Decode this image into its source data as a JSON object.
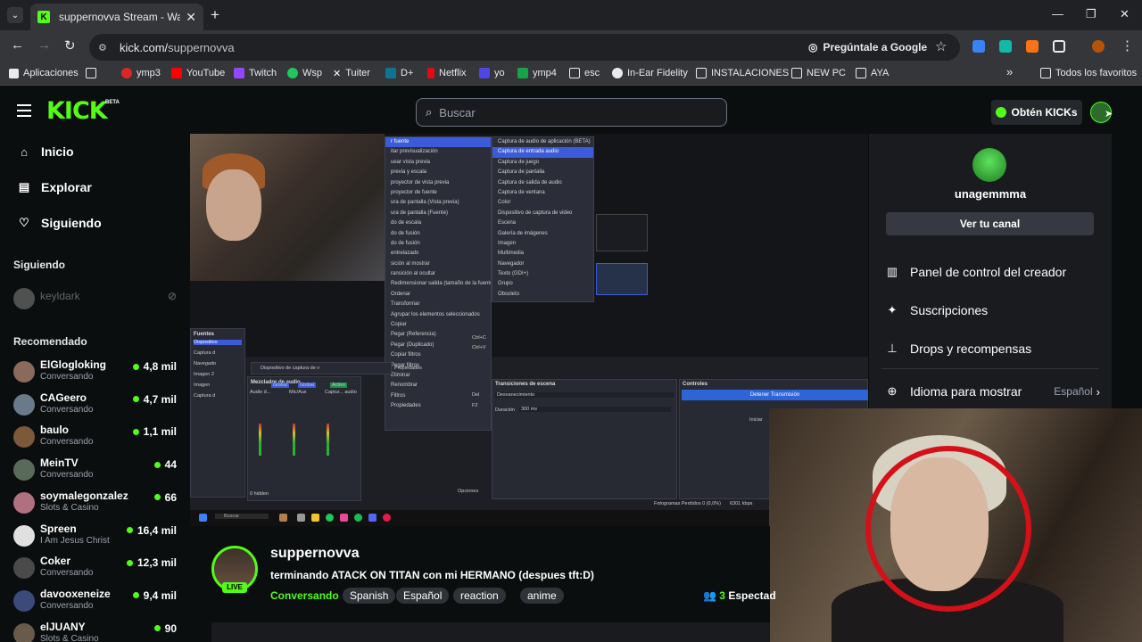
{
  "browser": {
    "tab_title": "suppernovva Stream - Watch Li",
    "url_host": "kick.com/",
    "url_path": "suppernovva",
    "google_pill": "Pregúntale a Google",
    "bookmarks": [
      "Aplicaciones",
      "ymp3",
      "YouTube",
      "Twitch",
      "Wsp",
      "Tuiter",
      "D+",
      "Netflix",
      "yo",
      "ymp4",
      "esc",
      "In-Ear Fidelity",
      "INSTALACIONES",
      "NEW PC",
      "AYA"
    ],
    "all_bookmarks": "Todos los favoritos",
    "more": "»"
  },
  "header": {
    "logo": "KICK",
    "beta": "BETA",
    "search_placeholder": "Buscar",
    "get_kicks": "Obtén KICKs"
  },
  "sidebar": {
    "nav": [
      {
        "label": "Inicio",
        "icon": "home-icon"
      },
      {
        "label": "Explorar",
        "icon": "explore-icon"
      },
      {
        "label": "Siguiendo",
        "icon": "heart-icon"
      }
    ],
    "following_heading": "Siguiendo",
    "following": [
      {
        "name": "keyldark"
      }
    ],
    "recommended_heading": "Recomendado",
    "recommended": [
      {
        "name": "ElGlogloking",
        "sub": "Conversando",
        "viewers": "4,8 mil",
        "color": "#8a6a5a"
      },
      {
        "name": "CAGeero",
        "sub": "Conversando",
        "viewers": "4,7 mil",
        "color": "#6a7a8a"
      },
      {
        "name": "baulo",
        "sub": "Conversando",
        "viewers": "1,1 mil",
        "color": "#7a5a3a"
      },
      {
        "name": "MeinTV",
        "sub": "Conversando",
        "viewers": "44",
        "color": "#5a6a5a"
      },
      {
        "name": "soymalegonzalez",
        "sub": "Slots & Casino",
        "viewers": "66",
        "color": "#b07080"
      },
      {
        "name": "Spreen",
        "sub": "I Am Jesus Christ",
        "viewers": "16,4 mil",
        "color": "#e0e0e0"
      },
      {
        "name": "Coker",
        "sub": "Conversando",
        "viewers": "12,3 mil",
        "color": "#4a4a4a"
      },
      {
        "name": "davooxeneize",
        "sub": "Conversando",
        "viewers": "9,4 mil",
        "color": "#3a4a7a"
      },
      {
        "name": "elJUANY",
        "sub": "Slots & Casino",
        "viewers": "90",
        "color": "#6a5a4a"
      }
    ]
  },
  "dropdown": {
    "username": "unagemmma",
    "view_channel": "Ver tu canal",
    "items": [
      {
        "label": "Panel de control del creador",
        "icon": "dashboard-icon"
      },
      {
        "label": "Suscripciones",
        "icon": "sparkle-icon"
      },
      {
        "label": "Drops y recompensas",
        "icon": "drops-icon"
      }
    ],
    "language_label": "Idioma para mostrar",
    "language_value": "Español"
  },
  "channel": {
    "name": "suppernovva",
    "live": "LIVE",
    "title": "terminando ATACK ON TITAN con mi HERMANO (despues tft:D)",
    "category": "Conversando",
    "tags": [
      "Spanish",
      "Español",
      "reaction",
      "anime"
    ],
    "viewers": "3",
    "viewers_label": "Espectad"
  },
  "obs": {
    "context_menu_left": [
      "r fuente",
      "itar previsualización",
      "uear vista previa",
      "previa y escala",
      "proyector de vista previa",
      "proyector de fuente",
      "ura de pantalla (Vista previa)",
      "ura de pantalla (Fuente)",
      "do de escala",
      "do de fusión",
      "do de fusión",
      "entrelazado",
      "sición al mostrar",
      "ransición al ocultar"
    ],
    "context_menu_rest": [
      "Redimensionar salida (tamaño de la fuente)",
      "Ordenar",
      "Transformar",
      "Agrupar los elementos seleccionados",
      "Copiar",
      "Pegar (Referencia)",
      "Pegar (Duplicado)",
      "Copiar filtros",
      "Pegar filtros",
      "Eliminar",
      "Renombrar",
      "Filtros",
      "Propiedades"
    ],
    "shortcuts": [
      "Ctrl+C",
      "Ctrl+V",
      "Del",
      "F2"
    ],
    "submenu": [
      "Captura de audio de aplicación (BETA)",
      "Captura de entrada audio",
      "Captura de juego",
      "Captura de pantalla",
      "Captura de salida de audio",
      "Captura de ventana",
      "Color",
      "Dispositivo de captura de video",
      "Escena",
      "Galería de imágenes",
      "Imagen",
      "Multimedia",
      "Navegador",
      "Texto (GDI+)",
      "Grupo",
      "Obsoleto"
    ],
    "sources_title": "Fuentes",
    "sources": [
      "Dispositivo",
      "Captura d",
      "Navegado",
      "Imagen 2",
      "Imagen",
      "Captura d"
    ],
    "mixer_title": "Mezclador de audio",
    "mixer_channels": [
      "Audio d...",
      "Mic/Aux",
      "Captur... audio"
    ],
    "mixer_tags": [
      "Global",
      "Global",
      "Activo"
    ],
    "transitions_title": "Transiciones de escena",
    "transition_value": "Desvanecimiento",
    "duration_label": "Duración",
    "duration_value": "300 ms",
    "controls_title": "Controles",
    "controls_button": "Detener Transmisión",
    "controls_start": "Iniciar",
    "device_tab": "Dispositivo de captura de v",
    "props_tab": "Propiedades",
    "search": "Buscar",
    "status": "Fotogramas Perdidos 0 (0,0%)",
    "kbps": "6301 kbps",
    "hidden": "0 hidden",
    "options": "Opciones"
  }
}
